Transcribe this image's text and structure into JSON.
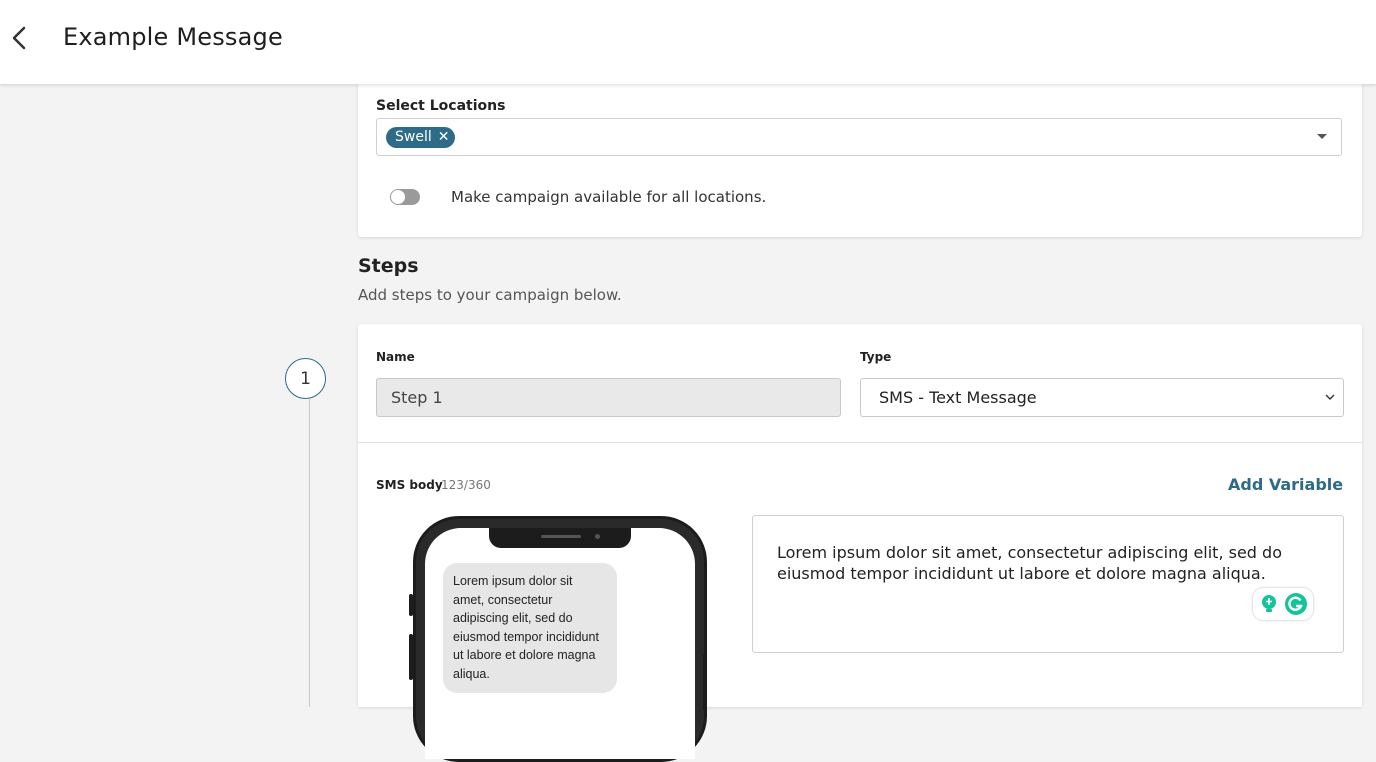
{
  "header": {
    "title": "Example Message"
  },
  "locations": {
    "label": "Select Locations",
    "selected_chip": "Swell",
    "chip_remove": "✕",
    "toggle_text": "Make campaign available for all locations."
  },
  "steps": {
    "heading": "Steps",
    "subtitle": "Add steps to your campaign below.",
    "items": [
      {
        "number": "1",
        "name_label": "Name",
        "name_value": "Step 1",
        "type_label": "Type",
        "type_value": "SMS - Text Message",
        "sms_label": "SMS body",
        "sms_count": "123/360",
        "add_variable": "Add Variable",
        "sms_body": "Lorem ipsum dolor sit amet, consectetur adipiscing elit, sed do eiusmod tempor incididunt ut labore et dolore magna aliqua.",
        "preview_bubble": "Lorem ipsum dolor sit amet, consectetur adipiscing elit, sed do eiusmod tempor incididunt ut labore et dolore magna aliqua."
      }
    ]
  },
  "colors": {
    "accent": "#2e6b87",
    "toggle_off": "#9a9a9a"
  },
  "icons": {
    "back": "chevron-left-icon",
    "dropdown": "caret-down-icon",
    "type_chevron": "chevron-down-icon",
    "extension": "grammarly-icon"
  }
}
